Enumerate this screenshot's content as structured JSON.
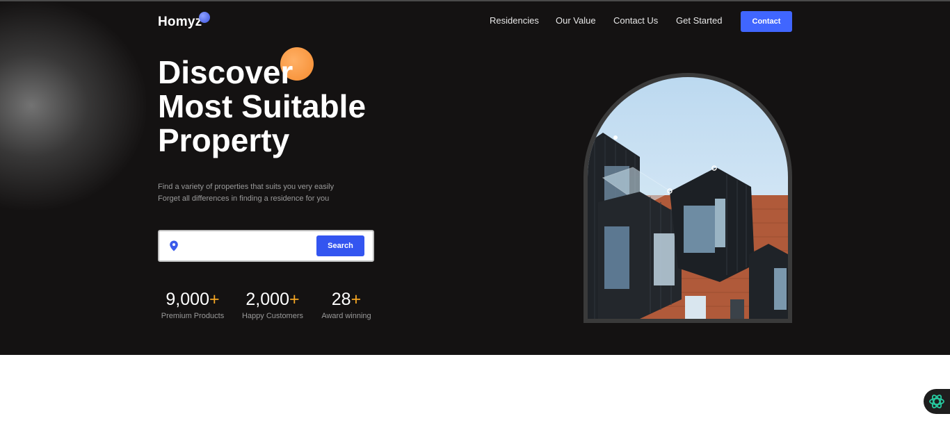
{
  "brand": {
    "name": "Homyz"
  },
  "nav": {
    "links": [
      "Residencies",
      "Our Value",
      "Contact Us",
      "Get Started"
    ],
    "contact_label": "Contact"
  },
  "hero": {
    "title_lines": [
      "Discover",
      "Most Suitable",
      "Property"
    ],
    "subtitle_lines": [
      "Find a variety of properties that suits you very easily",
      "Forget all differences in finding a residence for you"
    ],
    "search": {
      "value": "",
      "placeholder": "",
      "button_label": "Search"
    },
    "stats": [
      {
        "value": "9,000",
        "suffix": "+",
        "label": "Premium Products"
      },
      {
        "value": "2,000",
        "suffix": "+",
        "label": "Happy Customers"
      },
      {
        "value": "28",
        "suffix": "+",
        "label": "Award winning"
      }
    ]
  },
  "colors": {
    "accent": "#4066ff",
    "orange": "#f5a623",
    "hero_bg": "#141212"
  },
  "icons": [
    "location-pin-icon",
    "assistant-widget-icon"
  ]
}
